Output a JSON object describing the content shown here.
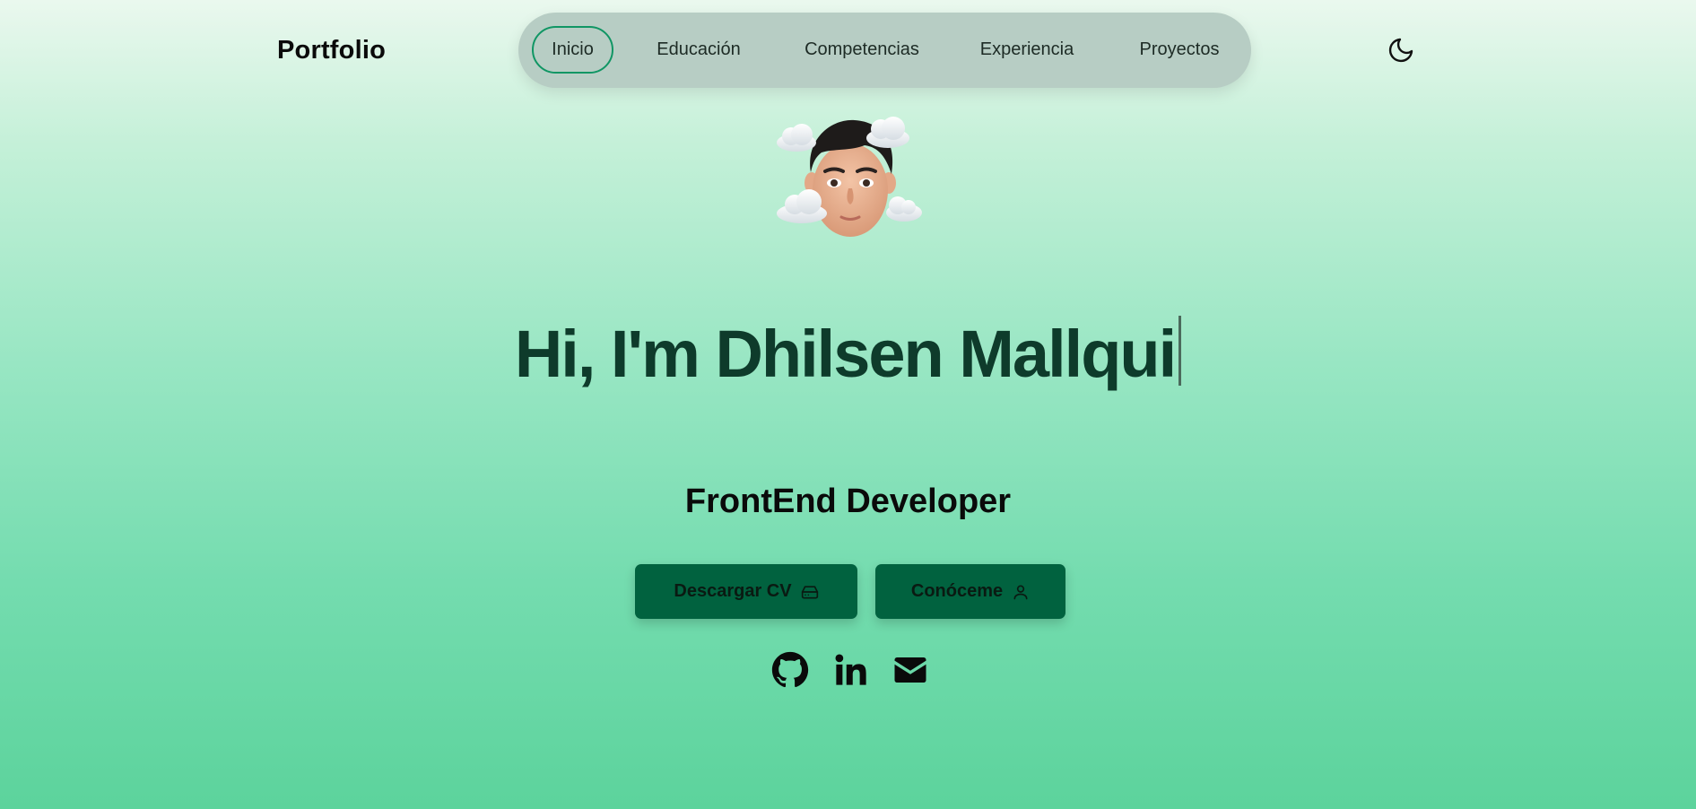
{
  "header": {
    "brand": "Portfolio",
    "nav": [
      {
        "label": "Inicio",
        "active": true
      },
      {
        "label": "Educación",
        "active": false
      },
      {
        "label": "Competencias",
        "active": false
      },
      {
        "label": "Experiencia",
        "active": false
      },
      {
        "label": "Proyectos",
        "active": false
      }
    ],
    "theme_toggle_icon": "moon-icon"
  },
  "hero": {
    "avatar_icon": "memoji-avatar-with-clouds",
    "headline": "Hi, I'm Dhilsen Mallqui",
    "role": "FrontEnd Developer",
    "buttons": [
      {
        "label": "Descargar CV",
        "icon": "hard-drive-icon"
      },
      {
        "label": "Conóceme",
        "icon": "user-icon"
      }
    ],
    "social_icons": [
      "github-icon",
      "linkedin-icon",
      "mail-icon"
    ]
  },
  "colors": {
    "accent": "#01623f",
    "nav_active_border": "#109664",
    "headline": "#0e3b2b",
    "nav_bg": "#b7cdc4"
  }
}
